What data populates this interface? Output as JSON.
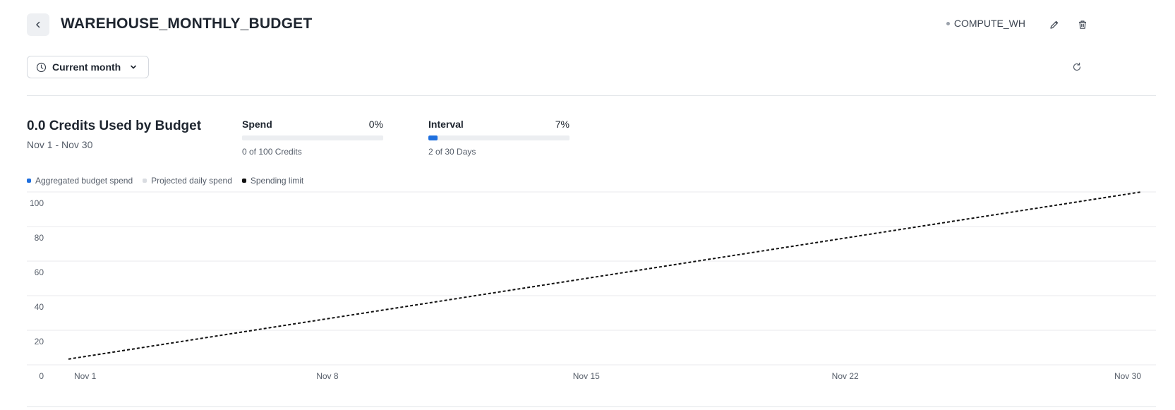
{
  "header": {
    "title": "WAREHOUSE_MONTHLY_BUDGET",
    "warehouse": "COMPUTE_WH",
    "back_icon": "chevron-left-icon",
    "edit_icon": "pencil-icon",
    "delete_icon": "trash-icon"
  },
  "toolbar": {
    "range_label": "Current month",
    "range_icon": "clock-icon",
    "dropdown_icon": "chevron-down-icon",
    "refresh_icon": "refresh-icon"
  },
  "summary": {
    "title": "0.0 Credits Used by Budget",
    "date_range": "Nov 1 - Nov 30"
  },
  "metrics": {
    "spend": {
      "label": "Spend",
      "percent_text": "0%",
      "fraction": 0.0,
      "sub": "0 of 100 Credits"
    },
    "interval": {
      "label": "Interval",
      "percent_text": "7%",
      "fraction": 0.0667,
      "sub": "2 of 30 Days"
    }
  },
  "colors": {
    "aggregated": "#1f6fde",
    "projected": "#d9dce1",
    "limit": "#111111",
    "grid": "#e8eaee"
  },
  "chart_data": {
    "type": "line",
    "title": "",
    "xlabel": "",
    "ylabel": "",
    "legend": [
      {
        "name": "Aggregated budget spend",
        "color": "#1f6fde"
      },
      {
        "name": "Projected daily spend",
        "color": "#d9dce1"
      },
      {
        "name": "Spending limit",
        "color": "#111111"
      }
    ],
    "legend_position": "top-left",
    "grid": true,
    "ylim": [
      0,
      100
    ],
    "yticks": [
      0,
      20,
      40,
      60,
      80,
      100
    ],
    "xlim": [
      1,
      30
    ],
    "xticks": [
      {
        "day": 1,
        "label": "Nov 1"
      },
      {
        "day": 8,
        "label": "Nov 8"
      },
      {
        "day": 15,
        "label": "Nov 15"
      },
      {
        "day": 22,
        "label": "Nov 22"
      },
      {
        "day": 30,
        "label": "Nov 30"
      }
    ],
    "series": [
      {
        "name": "Aggregated budget spend",
        "x": [
          1,
          2
        ],
        "values": [
          0,
          0
        ]
      },
      {
        "name": "Projected daily spend",
        "x": [],
        "values": []
      },
      {
        "name": "Spending limit",
        "style": "dashed",
        "x": [
          1,
          30
        ],
        "values": [
          3.33,
          100
        ]
      }
    ]
  }
}
